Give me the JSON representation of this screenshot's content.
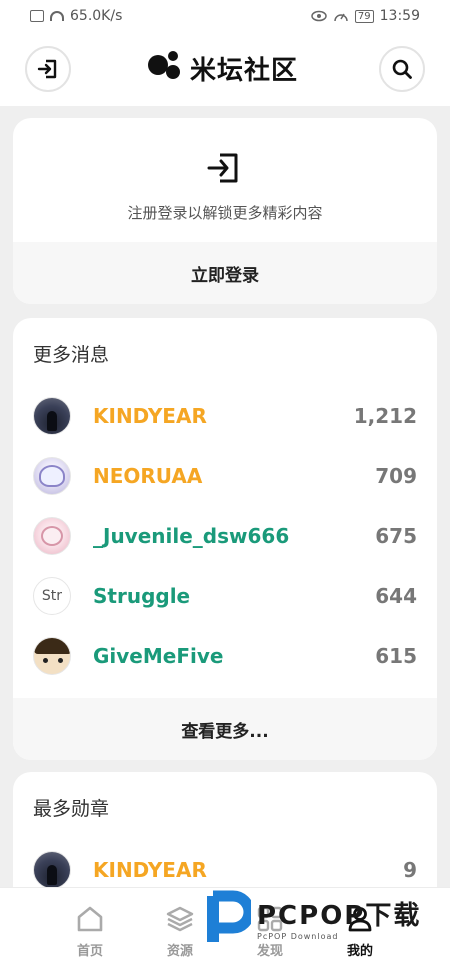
{
  "status_bar": {
    "network_speed": "65.0K/s",
    "battery": "79",
    "time": "13:59"
  },
  "header": {
    "title": "米坛社区"
  },
  "login_card": {
    "hint": "注册登录以解锁更多精彩内容",
    "login_button": "立即登录"
  },
  "news_section": {
    "title": "更多消息",
    "users": [
      {
        "name": "KINDYEAR",
        "count": "1,212",
        "color": "#f5a623"
      },
      {
        "name": "NEORUAA",
        "count": "709",
        "color": "#f5a623"
      },
      {
        "name": "_Juvenile_dsw666",
        "count": "675",
        "color": "#1a9a7a"
      },
      {
        "name": "Struggle",
        "count": "644",
        "color": "#1a9a7a"
      },
      {
        "name": "GiveMeFive",
        "count": "615",
        "color": "#1a9a7a"
      }
    ],
    "more_label": "查看更多..."
  },
  "medal_section": {
    "title": "最多勋章",
    "users": [
      {
        "name": "KINDYEAR",
        "count": "9",
        "color": "#f5a623"
      }
    ]
  },
  "tabbar": {
    "tabs": [
      {
        "label": "首页",
        "icon": "home-icon"
      },
      {
        "label": "资源",
        "icon": "layers-icon"
      },
      {
        "label": "发现",
        "icon": "discover-icon"
      },
      {
        "label": "我的",
        "icon": "user-icon"
      }
    ]
  },
  "watermark": {
    "main": "PCPOP下载",
    "sub": "PcPOP Download"
  },
  "colors": {
    "accent_orange": "#f5a623",
    "accent_green": "#1a9a7a",
    "background": "#efefef"
  }
}
